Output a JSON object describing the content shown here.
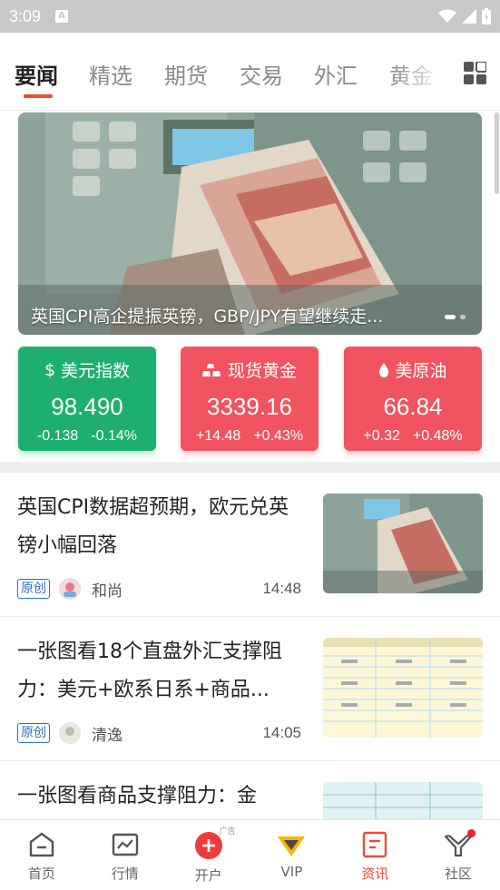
{
  "status_bar": {
    "time": "3:09"
  },
  "tabs": [
    "要闻",
    "精选",
    "期货",
    "交易",
    "外汇",
    "黄金"
  ],
  "active_tab_index": 0,
  "banner": {
    "caption": "英国CPI高企提振英镑，GBP/JPY有望继续走..."
  },
  "quotes": [
    {
      "symbol": "$",
      "name": "美元指数",
      "value": "98.490",
      "change": "-0.138",
      "percent": "-0.14%",
      "color": "#1eaf6f"
    },
    {
      "name": "现货黄金",
      "value": "3339.16",
      "change": "+14.48",
      "percent": "+0.43%",
      "color": "#f15360"
    },
    {
      "name": "美原油",
      "value": "66.84",
      "change": "+0.32",
      "percent": "+0.48%",
      "color": "#f15360"
    }
  ],
  "news": [
    {
      "title": "英国CPI数据超预期，欧元兑英镑小幅回落",
      "badge": "原创",
      "author": "和尚",
      "time": "14:48"
    },
    {
      "title": "一张图看18个直盘外汇支撑阻力：美元+欧系日系+商品...",
      "badge": "原创",
      "author": "清逸",
      "time": "14:05"
    },
    {
      "title": "一张图看商品支撑阻力：金"
    }
  ],
  "bottom_nav": [
    {
      "label": "首页",
      "icon": "home-icon"
    },
    {
      "label": "行情",
      "icon": "chart-icon"
    },
    {
      "label": "开户",
      "icon": "plus-circle-icon",
      "tag": "广告"
    },
    {
      "label": "VIP",
      "icon": "vip-icon"
    },
    {
      "label": "资讯",
      "icon": "news-icon",
      "active": true
    },
    {
      "label": "社区",
      "icon": "community-icon"
    }
  ],
  "colors": {
    "accent": "#ef4a35",
    "up": "#f15360",
    "down": "#1eaf6f",
    "badge": "#2f6fcc"
  }
}
